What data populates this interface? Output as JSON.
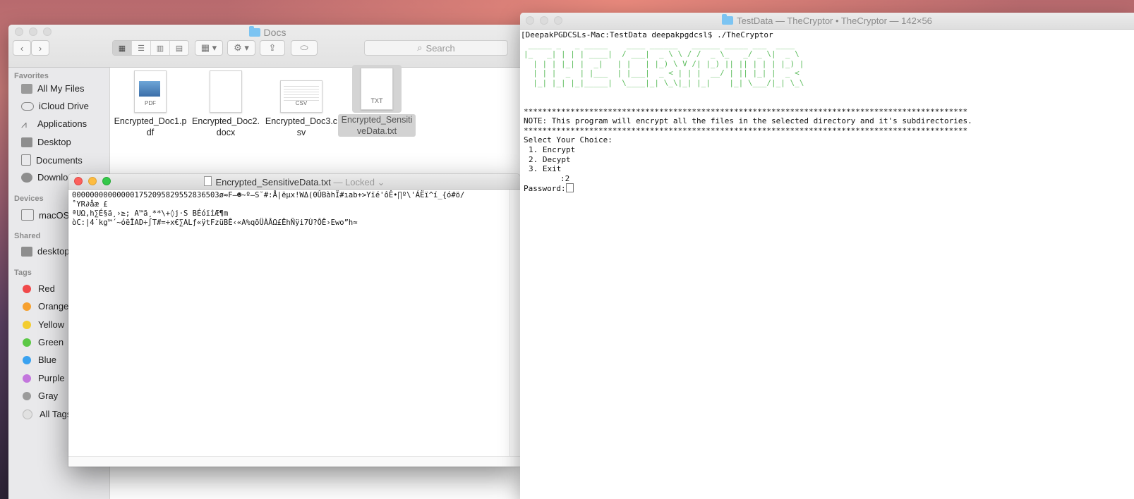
{
  "finder": {
    "title": "Docs",
    "search_placeholder": "Search",
    "sidebar": {
      "favorites_header": "Favorites",
      "favorites": [
        "All My Files",
        "iCloud Drive",
        "Applications",
        "Desktop",
        "Documents",
        "Downloads"
      ],
      "devices_header": "Devices",
      "devices": [
        "macOS"
      ],
      "shared_header": "Shared",
      "shared": [
        "desktop"
      ],
      "tags_header": "Tags",
      "tags": [
        {
          "label": "Red",
          "color": "#f0494a"
        },
        {
          "label": "Orange",
          "color": "#f6a02f"
        },
        {
          "label": "Yellow",
          "color": "#f3cd2f"
        },
        {
          "label": "Green",
          "color": "#5bc845"
        },
        {
          "label": "Blue",
          "color": "#3aa2f0"
        },
        {
          "label": "Purple",
          "color": "#c376dd"
        },
        {
          "label": "Gray",
          "color": "#9b9b9b"
        },
        {
          "label": "All Tags...",
          "color": "#e1e1e1"
        }
      ]
    },
    "files": [
      {
        "name_line1": "Encrypted_Doc1.p",
        "name_line2": "df",
        "ext": "PDF"
      },
      {
        "name_line1": "Encrypted_Doc2.",
        "name_line2": "docx",
        "ext": ""
      },
      {
        "name_line1": "Encrypted_Doc3.c",
        "name_line2": "sv",
        "ext": "CSV"
      },
      {
        "name_line1": "Encrypted_Sensiti",
        "name_line2": "veData.txt",
        "ext": "TXT"
      }
    ]
  },
  "textedit": {
    "filename": "Encrypted_SensitiveData.txt",
    "status": "— Locked",
    "lines": [
      "000000000000001752095829552836503ø≈F–☻~º—S˘#:Å|ëµx!WΔ(0ÛBàhÏ#ıab+>Yïé'ôÊ•∏º\\'ÁËï^í_{ó#ö/",
      "˚YR∂åæ £",
      "ªUΩ,h∑É§ä¸›≥; A™ã¸**\\+◊j·S BÉóïîÆ¶m",
      "òC:|4˙kg™´~óëÎAD÷∫T#=÷x€∑ALƒ«ÿtFzüBÊ‹«A%qõÜÀÂΩ£ÊhÑÿi7Ù?ÔÊ›Ewo”h≈"
    ]
  },
  "terminal": {
    "title": "TestData — TheCryptor • TheCryptor — 142×56",
    "prompt": "[DeepakPGDCSLs-Mac:TestData deepakpgdcsl$ ./TheCryptor",
    "ascii_art": [
      " _____ _   _ _____    ____ ______   ______ _____ ___  ____  ",
      "|_   _| | | | ____|  / ___|  _ \\ \\ / /  _ \\_   _/ _ \\|  _ \\ ",
      "  | | | |_| |  _|   | |   | |_) \\ V /| |_) || || | | | |_) |",
      "  | | |  _  | |___  | |___|  _ < | | |  __/ | || |_| |  _ < ",
      "  |_| |_| |_|_____|  \\____|_| \\_\\|_| |_|    |_| \\___/|_| \\_\\"
    ],
    "stars": "***********************************************************************************************",
    "note": "NOTE: This program will encrypt all the files in the selected directory and it's subdirectories.",
    "select": "Select Your Choice:",
    "options": [
      "1. Encrypt",
      "2. Decypt",
      "3. Exit"
    ],
    "choice": ":2",
    "password_label": "Password:"
  }
}
